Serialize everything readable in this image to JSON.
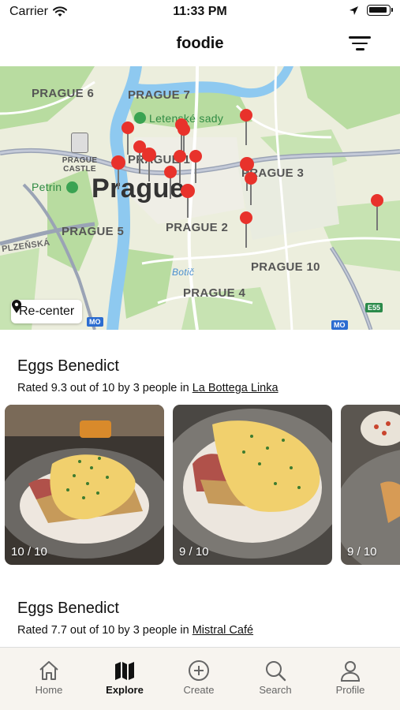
{
  "status_bar": {
    "carrier": "Carrier",
    "time": "11:33 PM"
  },
  "header": {
    "title": "foodie",
    "filter_icon": "filter-lines-icon"
  },
  "map": {
    "labels": {
      "prague6": "PRAGUE 6",
      "prague7": "PRAGUE 7",
      "prague1": "PRAGUE 1",
      "prague3": "PRAGUE 3",
      "prague2": "PRAGUE 2",
      "prague5": "PRAGUE 5",
      "prague10": "PRAGUE 10",
      "prague4": "PRAGUE 4",
      "prague": "Prague",
      "castle": "PRAGUE CASTLE",
      "letenske": "Letenské sady",
      "petrin": "Petrin",
      "plzenska": "PLZEŇSKÁ",
      "botic": "Botič",
      "e55": "E55",
      "mo_left": "MO",
      "mo_right": "MO"
    },
    "recenter_label": "Re-center",
    "pin_color": "#e8322b"
  },
  "feed": {
    "posts": [
      {
        "title": "Eggs Benedict",
        "subtitle_prefix": "Rated 9.3 out of 10 by 3 people in ",
        "place": "La Bottega Linka",
        "photos": [
          {
            "score": "10 / 10"
          },
          {
            "score": "9 / 10"
          },
          {
            "score": "9 / 10"
          }
        ]
      },
      {
        "title": "Eggs Benedict",
        "subtitle_prefix": "Rated 7.7 out of 10 by 3 people in ",
        "place": "Mistral Café"
      }
    ]
  },
  "tabbar": {
    "tabs": [
      {
        "label": "Home",
        "icon": "home-icon"
      },
      {
        "label": "Explore",
        "icon": "map-icon",
        "active": true
      },
      {
        "label": "Create",
        "icon": "plus-circle-icon"
      },
      {
        "label": "Search",
        "icon": "search-icon"
      },
      {
        "label": "Profile",
        "icon": "person-icon"
      }
    ]
  },
  "colors": {
    "accent_pin": "#e8322b",
    "river": "#8ec9f0",
    "park": "#b8dca0",
    "tabbar_bg": "#f7f4ee"
  }
}
